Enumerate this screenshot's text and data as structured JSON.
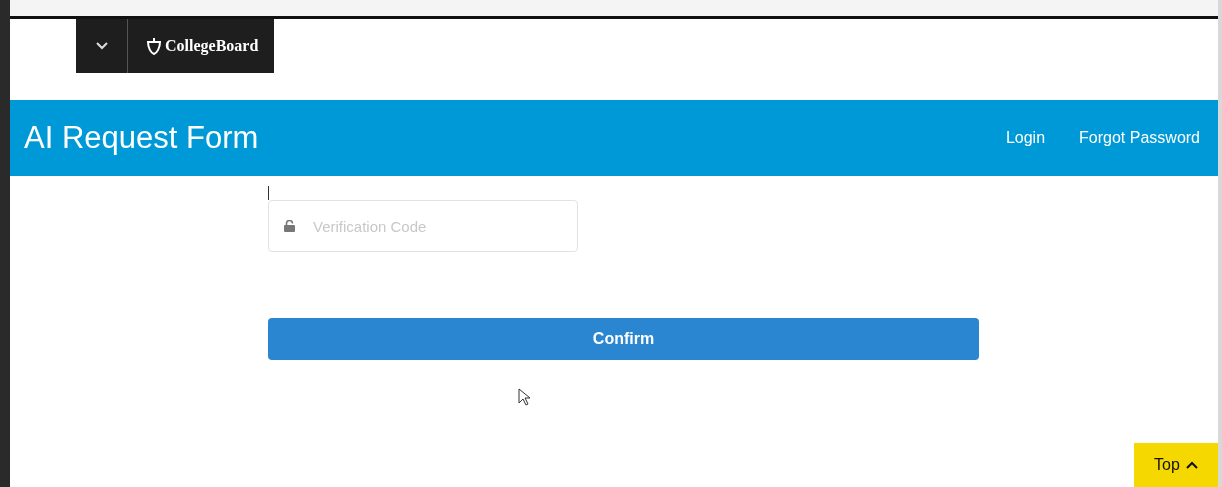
{
  "brand": {
    "name": "CollegeBoard"
  },
  "header": {
    "title": "AI Request Form",
    "links": [
      "Login",
      "Forgot Password"
    ]
  },
  "form": {
    "verification": {
      "placeholder": "Verification Code"
    },
    "submit": "Confirm"
  },
  "back_to_top": {
    "label": "Top"
  }
}
